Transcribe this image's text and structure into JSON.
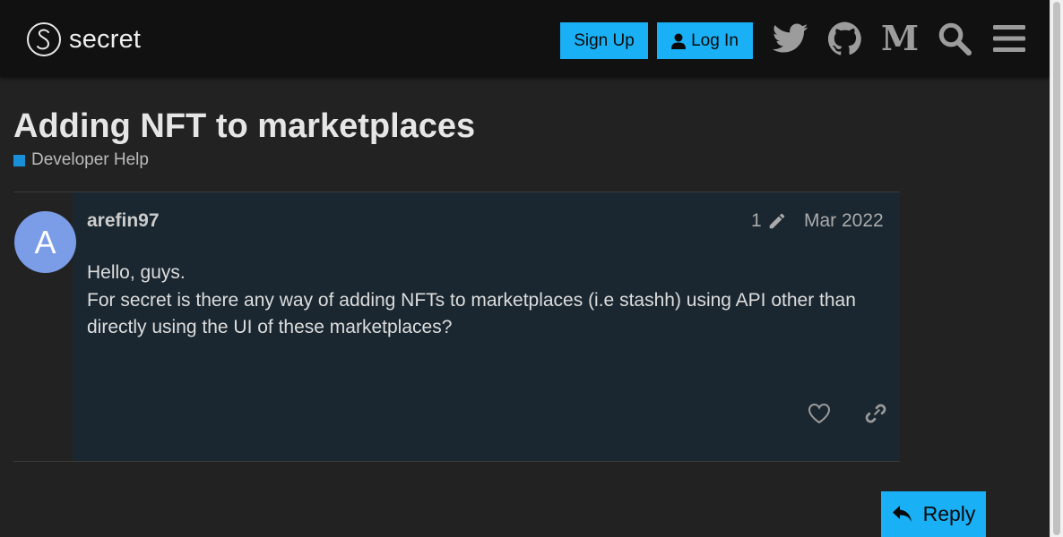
{
  "header": {
    "logo_text": "secret",
    "logo_icon": "secret-s-icon",
    "signup_label": "Sign Up",
    "login_label": "Log In",
    "icons": [
      "twitter-icon",
      "github-icon",
      "medium-icon",
      "search-icon",
      "menu-icon"
    ],
    "medium_glyph": "M"
  },
  "topic": {
    "title": "Adding NFT to marketplaces",
    "category": "Developer Help",
    "category_color": "#1a8fd9"
  },
  "post": {
    "avatar_letter": "A",
    "avatar_color": "#7b9ce6",
    "username": "arefin97",
    "edit_count": "1",
    "date": "Mar 2022",
    "line1": "Hello, guys.",
    "line2": "For secret is there any way of adding NFTs to marketplaces (i.e stashh) using API other than directly using the UI of these marketplaces?"
  },
  "actions": {
    "reply_label": "Reply"
  },
  "colors": {
    "accent": "#1ab0f5",
    "header_bg": "#111111",
    "page_bg": "#222222",
    "post_bg": "#1a2730"
  }
}
